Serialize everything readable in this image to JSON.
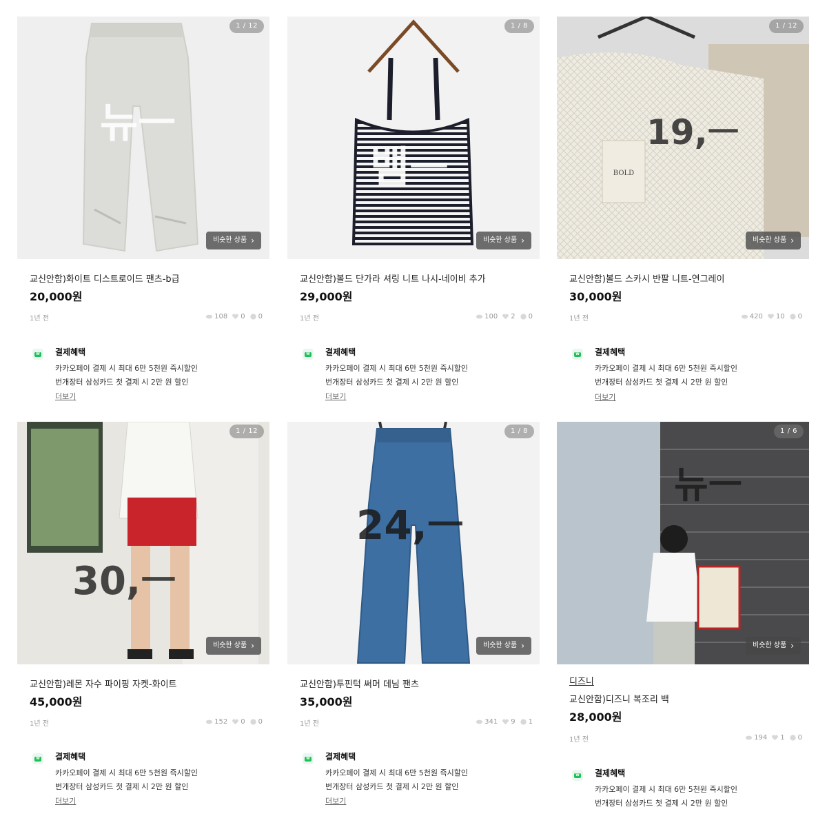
{
  "listings": [
    {
      "image_counter": "1 / 12",
      "overlay_text": "뉴ㅡ",
      "similar_label": "비슷한 상품",
      "brand": "",
      "title": "교신안함)화이트 디스트로이드 팬츠-b급",
      "price": "20,000원",
      "time_ago": "1년 전",
      "views": "108",
      "likes": "0",
      "chats": "0"
    },
    {
      "image_counter": "1 / 8",
      "overlay_text": "뱀ㅡ",
      "similar_label": "비슷한 상품",
      "brand": "",
      "title": "교신안함)볼드 단가라 셔링 니트 나시-네이비 추가",
      "price": "29,000원",
      "time_ago": "1년 전",
      "views": "100",
      "likes": "2",
      "chats": "0"
    },
    {
      "image_counter": "1 / 12",
      "overlay_text": "19,ㅡ",
      "tag_text": "BOLD",
      "similar_label": "비슷한 상품",
      "brand": "",
      "title": "교신안함)볼드 스카시 반팔 니트-연그레이",
      "price": "30,000원",
      "time_ago": "1년 전",
      "views": "420",
      "likes": "10",
      "chats": "0"
    },
    {
      "image_counter": "1 / 12",
      "overlay_text": "30,ㅡ",
      "similar_label": "비슷한 상품",
      "brand": "",
      "title": "교신안함)레몬 자수 파이핑 자켓-화이트",
      "price": "45,000원",
      "time_ago": "1년 전",
      "views": "152",
      "likes": "0",
      "chats": "0"
    },
    {
      "image_counter": "1 / 8",
      "overlay_text": "24,ㅡ",
      "similar_label": "비슷한 상품",
      "brand": "",
      "title": "교신안함)투핀턱 써머 데님 팬츠",
      "price": "35,000원",
      "time_ago": "1년 전",
      "views": "341",
      "likes": "9",
      "chats": "1"
    },
    {
      "image_counter": "1 / 6",
      "overlay_text": "뉴ㅡ",
      "similar_label": "비슷한 상품",
      "brand": "디즈니",
      "title": "교신안함)디즈니 복조리 백",
      "price": "28,000원",
      "time_ago": "1년 전",
      "views": "194",
      "likes": "1",
      "chats": "0"
    }
  ],
  "benefit": {
    "logo_text": "W",
    "title": "결제혜택",
    "line1": "카카오페이 결제 시 최대 6만 5천원 즉시할인",
    "line2": "번개장터 삼성카드 첫 결제 시 2만 원  할인",
    "more": "더보기"
  },
  "icons": {
    "views": "eye-icon",
    "likes": "heart-icon",
    "chats": "chat-bubble-icon",
    "chevron": "chevron-right-icon"
  },
  "colors": {
    "accent_green": "#1fbf5b",
    "muted_text": "#9a9a9a",
    "photo_bg": "#f2f2f2"
  }
}
